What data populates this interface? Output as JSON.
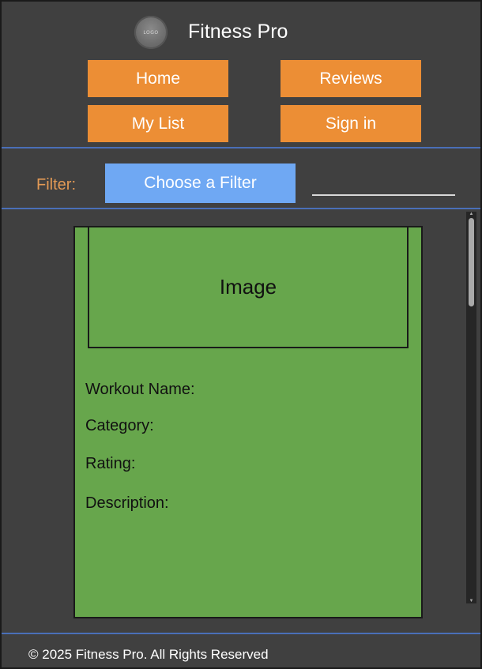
{
  "header": {
    "logo_text": "LOGO",
    "title": "Fitness Pro"
  },
  "nav": {
    "home": "Home",
    "reviews": "Reviews",
    "my_list": "My List",
    "sign_in": "Sign in"
  },
  "filter": {
    "label": "Filter:",
    "select_label": "Choose a Filter",
    "input_value": ""
  },
  "card": {
    "image_label": "Image",
    "fields": {
      "workout_name": "Workout Name:",
      "category": "Category:",
      "rating": "Rating:",
      "description": "Description:"
    }
  },
  "footer": {
    "text": "© 2025 Fitness Pro. All Rights Reserved"
  },
  "colors": {
    "background": "#404040",
    "accent_orange": "#ec8e35",
    "filter_blue": "#6fa8f3",
    "card_green": "#67a64c",
    "divider_blue": "#4a6fb8",
    "filter_label": "#e39a55"
  },
  "icons": {
    "logo": "logo-icon",
    "scroll_up": "chevron-up-icon",
    "scroll_down": "chevron-down-icon"
  }
}
